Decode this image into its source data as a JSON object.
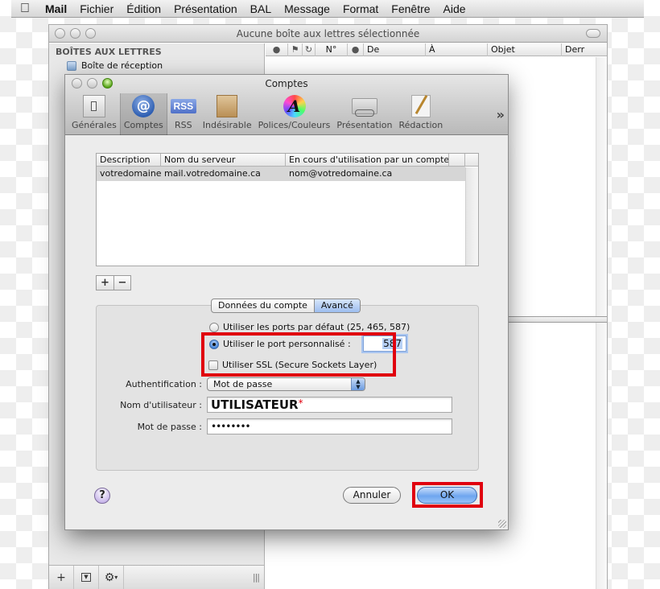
{
  "menubar": {
    "app": "Mail",
    "items": [
      "Fichier",
      "Édition",
      "Présentation",
      "BAL",
      "Message",
      "Format",
      "Fenêtre",
      "Aide"
    ]
  },
  "mail_window": {
    "title": "Aucune boîte aux lettres sélectionnée",
    "sidebar": {
      "heading": "BOÎTES AUX LETTRES",
      "items": [
        {
          "label": "Boîte de réception",
          "icon": "inbox-icon"
        }
      ],
      "footer": {
        "add": "+",
        "gear_caret": "▾",
        "grip": "|||"
      }
    },
    "message_columns": [
      "●",
      "⚑",
      "↻",
      "N°",
      "●",
      "De",
      "À",
      "Objet",
      "Derr"
    ]
  },
  "dialog": {
    "title": "Comptes",
    "toolbar": [
      {
        "label": "Générales",
        "icon": "general-switch-icon",
        "active": false
      },
      {
        "label": "Comptes",
        "icon": "at-sign-icon",
        "active": true
      },
      {
        "label": "RSS",
        "icon": "rss-icon",
        "active": false,
        "icon_text": "RSS"
      },
      {
        "label": "Indésirable",
        "icon": "junk-bag-icon",
        "active": false
      },
      {
        "label": "Polices/Couleurs",
        "icon": "fonts-colors-icon",
        "active": false,
        "icon_text": "A"
      },
      {
        "label": "Présentation",
        "icon": "viewing-icon",
        "active": false
      },
      {
        "label": "Rédaction",
        "icon": "composing-icon",
        "active": false
      }
    ],
    "toolbar_overflow": "»",
    "accounts_table": {
      "columns": [
        "Description",
        "Nom du serveur",
        "En cours d'utilisation par un compte"
      ],
      "rows": [
        {
          "description": "votredomaine",
          "server": "mail.votredomaine.ca",
          "account": "nom@votredomaine.ca",
          "selected": true
        }
      ]
    },
    "add_label": "+",
    "remove_label": "−",
    "tabs": [
      {
        "label": "Données du compte",
        "selected": false
      },
      {
        "label": "Avancé",
        "selected": true
      }
    ],
    "advanced": {
      "radio_default": {
        "label": "Utiliser les ports par défaut (25, 465, 587)",
        "checked": false
      },
      "radio_custom": {
        "label": "Utiliser le port personnalisé :",
        "checked": true
      },
      "custom_port": "587",
      "ssl": {
        "label": "Utiliser SSL (Secure Sockets Layer)",
        "checked": false
      }
    },
    "form": {
      "auth_label": "Authentification :",
      "auth_value": "Mot de passe",
      "username_label": "Nom d'utilisateur :",
      "username_value": "UTILISATEUR",
      "username_marker": "*",
      "password_label": "Mot de passe :",
      "password_value": "••••••••"
    },
    "help_label": "?",
    "cancel_label": "Annuler",
    "ok_label": "OK",
    "highlight_color": "#e0000e"
  }
}
